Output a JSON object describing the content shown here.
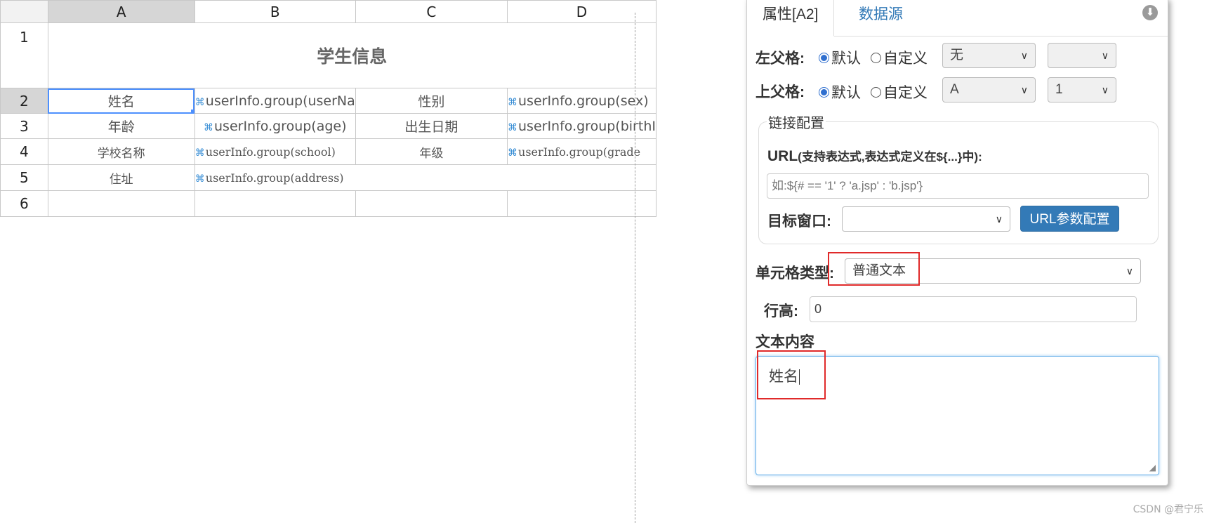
{
  "sheet": {
    "columns": [
      "A",
      "B",
      "C",
      "D"
    ],
    "rows": [
      "1",
      "2",
      "3",
      "4",
      "5",
      "6"
    ],
    "title": "学生信息",
    "cells": {
      "a2": "姓名",
      "b2": "userInfo.group(userNa",
      "c2": "性别",
      "d2": "userInfo.group(sex)",
      "a3": "年龄",
      "b3": "userInfo.group(age)",
      "c3": "出生日期",
      "d3": "userInfo.group(birthI",
      "a4": "学校名称",
      "b4": "userInfo.group(school)",
      "c4": "年级",
      "d4": "userInfo.group(grade",
      "a5": "住址",
      "b5": "userInfo.group(address)"
    }
  },
  "panel": {
    "tabs": [
      "属性[A2]",
      "数据源"
    ],
    "left_parent": {
      "label": "左父格:",
      "default_label": "默认",
      "custom_label": "自定义",
      "select1": "无",
      "select2": ""
    },
    "top_parent": {
      "label": "上父格:",
      "default_label": "默认",
      "custom_label": "自定义",
      "select1": "A",
      "select2": "1"
    },
    "link": {
      "legend": "链接配置",
      "url_label": "URL",
      "url_hint": "(支持表达式,表达式定义在${...}中):",
      "url_placeholder": "如:${# == '1' ? 'a.jsp' : 'b.jsp'}",
      "target_label": "目标窗口:",
      "target_value": "",
      "param_button": "URL参数配置"
    },
    "cell_type": {
      "label": "单元格类型:",
      "value": "普通文本"
    },
    "row_height": {
      "label": "行高:",
      "value": "0"
    },
    "text_content": {
      "label": "文本内容",
      "value": "姓名"
    }
  },
  "colors": {
    "accent": "#337ab7",
    "highlight": "#e02a2a",
    "selection": "#4d90fe"
  },
  "watermark": "CSDN @君宁乐"
}
